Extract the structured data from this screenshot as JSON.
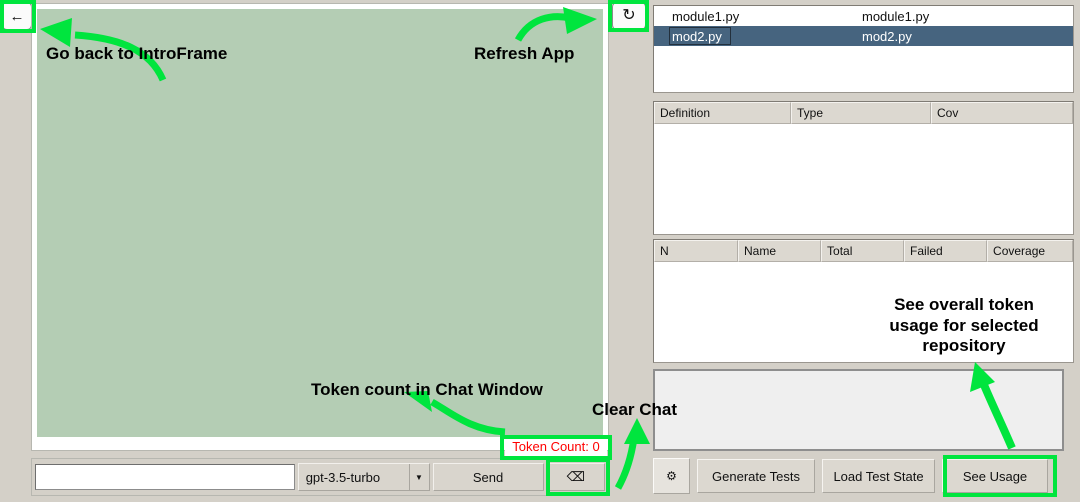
{
  "left": {
    "back_button": {
      "icon": "arrow-left-icon",
      "glyph": "←"
    },
    "refresh_button": {
      "icon": "refresh-icon",
      "glyph": "↻"
    },
    "token_count": "Token Count: 0",
    "chat_input_value": "",
    "chat_input_placeholder": "",
    "model_select": {
      "value": "gpt-3.5-turbo",
      "options": [
        "gpt-3.5-turbo"
      ],
      "arrow": "▼"
    },
    "send_label": "Send",
    "clear_button": {
      "icon": "backspace-icon",
      "glyph": "⌫"
    }
  },
  "right": {
    "file_list": {
      "rows": [
        {
          "name": "module1.py",
          "path": "module1.py",
          "selected": false
        },
        {
          "name": "mod2.py",
          "path": "mod2.py",
          "selected": true
        }
      ]
    },
    "definition_table": {
      "headers": [
        "Definition",
        "Type",
        "Cov"
      ],
      "rows": []
    },
    "test_table": {
      "headers": [
        "N",
        "Name",
        "Total",
        "Failed",
        "Coverage"
      ],
      "rows": []
    },
    "usage_box_text": "",
    "buttons": {
      "settings": {
        "icon": "gear-icon",
        "glyph": "⚙"
      },
      "generate_tests": "Generate Tests",
      "load_test_state": "Load Test State",
      "see_usage": "See Usage"
    }
  },
  "annotations": {
    "highlight_color": "#00e53e",
    "back": "Go back to IntroFrame",
    "refresh": "Refresh App",
    "token": "Token count in Chat Window",
    "clear": "Clear Chat",
    "usage": "See overall token usage for selected repository"
  }
}
